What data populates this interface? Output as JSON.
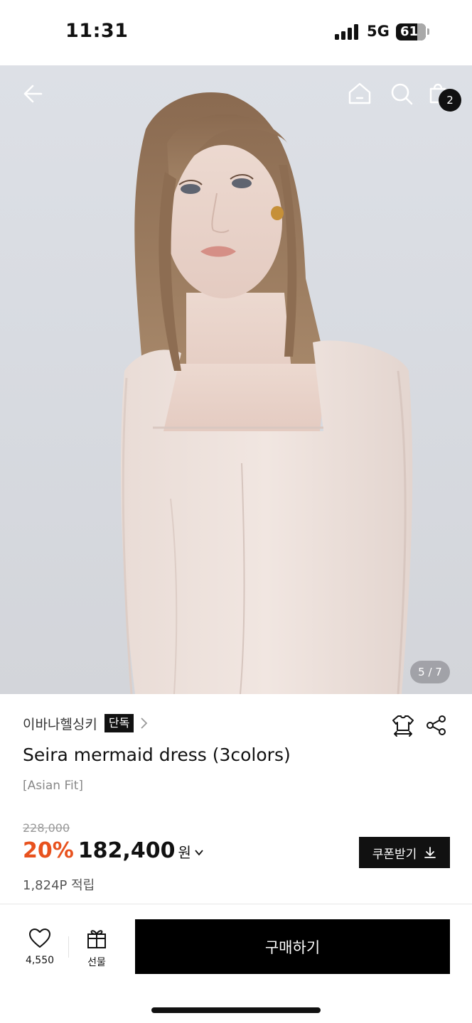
{
  "status_bar": {
    "time": "11:31",
    "network": "5G",
    "battery": "61"
  },
  "hero": {
    "image_counter": "5 / 7",
    "cart_count": "2"
  },
  "icons": {
    "back": "arrow-left-icon",
    "home": "home-icon",
    "search": "search-icon",
    "cart": "shopping-bag-icon",
    "size": "size-guide-icon",
    "share": "share-icon",
    "like": "heart-icon",
    "gift": "gift-icon"
  },
  "product": {
    "brand": "이바나헬싱키",
    "exclusive_tag": "단독",
    "name": "Seira mermaid dress (3colors)",
    "fit_note": "[Asian Fit]",
    "original_price": "228,000",
    "discount_rate": "20%",
    "sale_price": "182,400",
    "currency": "원",
    "coupon_label": "쿠폰받기",
    "points": "1,824P 적립"
  },
  "bottom_bar": {
    "like_count": "4,550",
    "gift_label": "선물",
    "buy_label": "구매하기"
  },
  "colors": {
    "accent_discount": "#e8521e",
    "primary_button": "#000000"
  }
}
